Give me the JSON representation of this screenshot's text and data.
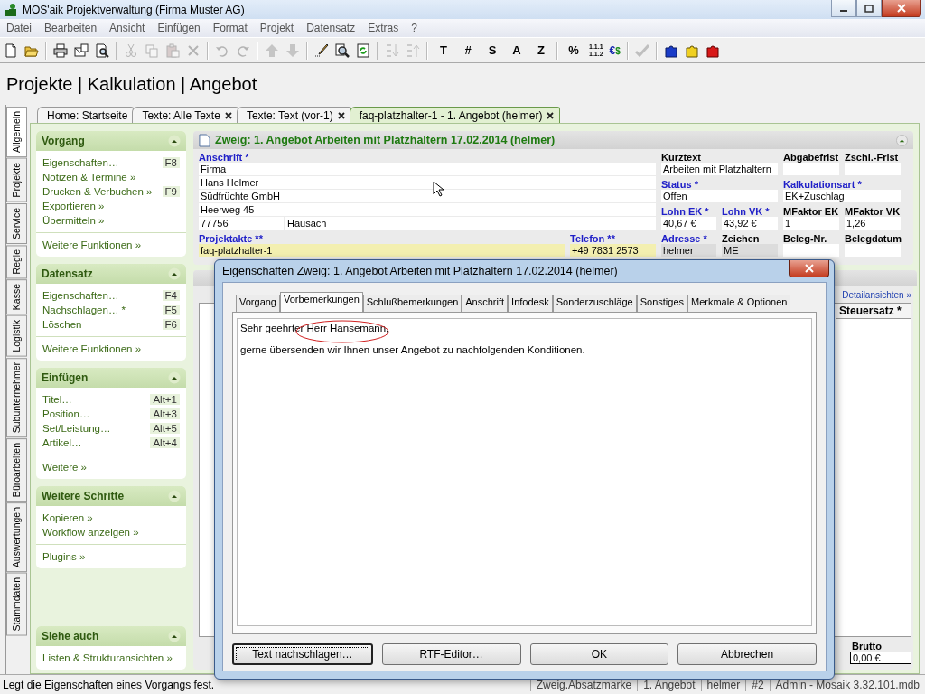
{
  "window": {
    "title": "MOS'aik Projektverwaltung (Firma Muster AG)"
  },
  "menu": [
    "Datei",
    "Bearbeiten",
    "Ansicht",
    "Einfügen",
    "Format",
    "Projekt",
    "Datensatz",
    "Extras",
    "?"
  ],
  "toolbar": [
    {
      "kind": "icon",
      "disabled": false
    },
    {
      "kind": "icon",
      "disabled": false
    },
    {
      "kind": "separator"
    },
    {
      "kind": "icon",
      "disabled": false
    },
    {
      "kind": "icon",
      "disabled": false
    },
    {
      "kind": "icon",
      "disabled": false
    },
    {
      "kind": "separator"
    },
    {
      "kind": "icon",
      "disabled": true
    },
    {
      "kind": "icon",
      "disabled": true
    },
    {
      "kind": "icon",
      "disabled": true
    },
    {
      "kind": "icon",
      "disabled": true
    },
    {
      "kind": "separator"
    },
    {
      "kind": "icon",
      "disabled": true
    },
    {
      "kind": "icon",
      "disabled": true
    },
    {
      "kind": "separator"
    },
    {
      "kind": "icon",
      "disabled": true
    },
    {
      "kind": "icon",
      "disabled": true
    },
    {
      "kind": "separator"
    },
    {
      "kind": "icon",
      "disabled": false
    },
    {
      "kind": "icon",
      "disabled": false
    },
    {
      "kind": "icon",
      "disabled": false
    },
    {
      "kind": "separator"
    },
    {
      "kind": "icon",
      "disabled": true
    },
    {
      "kind": "icon",
      "disabled": true
    },
    {
      "kind": "separator"
    },
    {
      "kind": "text",
      "label": "T"
    },
    {
      "kind": "text",
      "label": "#"
    },
    {
      "kind": "text",
      "label": "S"
    },
    {
      "kind": "text",
      "label": "A"
    },
    {
      "kind": "text",
      "label": "Z"
    },
    {
      "kind": "separator"
    },
    {
      "kind": "text",
      "label": "%"
    },
    {
      "kind": "stack",
      "lines": [
        "1.1.1",
        "1.1.2"
      ]
    },
    {
      "kind": "pair",
      "parts": [
        "€",
        "$"
      ]
    },
    {
      "kind": "separator"
    },
    {
      "kind": "icon",
      "disabled": true
    },
    {
      "kind": "separator"
    },
    {
      "kind": "icon",
      "disabled": false
    },
    {
      "kind": "icon",
      "disabled": false
    },
    {
      "kind": "icon",
      "disabled": false
    }
  ],
  "breadcrumb": "Projekte | Kalkulation | Angebot",
  "side_tabs": [
    {
      "label": "Allgemein",
      "selected": true
    },
    {
      "label": "Projekte",
      "selected": false
    },
    {
      "label": "Service",
      "selected": false
    },
    {
      "label": "Regie",
      "selected": false
    },
    {
      "label": "Kasse",
      "selected": false
    },
    {
      "label": "Logistik",
      "selected": false
    },
    {
      "label": "Subunternehmer",
      "selected": false
    },
    {
      "label": "Büroarbeiten",
      "selected": false
    },
    {
      "label": "Auswertungen",
      "selected": false
    },
    {
      "label": "Stammdaten",
      "selected": false
    }
  ],
  "doc_tabs": [
    {
      "label": "Home: Startseite",
      "closable": false,
      "selected": false
    },
    {
      "label": "Texte: Alle Texte",
      "closable": true,
      "selected": false
    },
    {
      "label": "Texte: Text (vor-1)",
      "closable": true,
      "selected": false
    },
    {
      "label": "faq-platzhalter-1 - 1. Angebot (helmer)",
      "closable": true,
      "selected": true
    }
  ],
  "task_panes": [
    {
      "title": "Vorgang",
      "expanded": true,
      "groups": [
        [
          {
            "label": "Eigenschaften…",
            "key": "F8"
          },
          {
            "label": "Notizen & Termine »"
          },
          {
            "label": "Drucken & Verbuchen »",
            "key": "F9"
          },
          {
            "label": "Exportieren »"
          },
          {
            "label": "Übermitteln »"
          }
        ],
        [
          {
            "label": "Weitere Funktionen »"
          }
        ]
      ]
    },
    {
      "title": "Datensatz",
      "expanded": true,
      "groups": [
        [
          {
            "label": "Eigenschaften…",
            "key": "F4"
          },
          {
            "label": "Nachschlagen… *",
            "key": "F5"
          },
          {
            "label": "Löschen",
            "key": "F6"
          }
        ],
        [
          {
            "label": "Weitere Funktionen »"
          }
        ]
      ]
    },
    {
      "title": "Einfügen",
      "expanded": true,
      "groups": [
        [
          {
            "label": "Titel…",
            "key": "Alt+1"
          },
          {
            "label": "Position…",
            "key": "Alt+3"
          },
          {
            "label": "Set/Leistung…",
            "key": "Alt+5"
          },
          {
            "label": "Artikel…",
            "key": "Alt+4"
          }
        ],
        [
          {
            "label": "Weitere »"
          }
        ]
      ]
    },
    {
      "title": "Weitere Schritte",
      "expanded": true,
      "groups": [
        [
          {
            "label": "Kopieren »"
          },
          {
            "label": "Workflow anzeigen »"
          }
        ],
        [
          {
            "label": "Plugins »"
          }
        ]
      ]
    },
    {
      "title": "Siehe auch",
      "expanded": true,
      "groups": [
        [
          {
            "label": "Listen & Strukturansichten »"
          }
        ]
      ]
    }
  ],
  "record": {
    "title": "Zweig: 1. Angebot Arbeiten mit Platzhaltern 17.02.2014 (helmer)",
    "expanded": true,
    "anschrift": {
      "label": "Anschrift *",
      "required": true,
      "lines": [
        "Firma",
        "Hans Helmer",
        "Südfrüchte GmbH",
        "Heerweg 45"
      ],
      "zip": "77756",
      "city": "Hausach"
    },
    "kurztext": {
      "label": "Kurztext",
      "required": false,
      "kind": "input",
      "value": "Arbeiten mit Platzhaltern"
    },
    "abgabefrist": {
      "label": "Abgabefrist",
      "required": false,
      "kind": "input"
    },
    "zschl_frist": {
      "label": "Zschl.-Frist",
      "required": false,
      "kind": "input"
    },
    "status": {
      "label": "Status *",
      "required": true,
      "kind": "input",
      "value": "Offen"
    },
    "kalkulationsart": {
      "label": "Kalkulationsart *",
      "required": true,
      "kind": "input",
      "value": "EK+Zuschlag"
    },
    "lohn_ek": {
      "label": "Lohn EK *",
      "required": true,
      "kind": "input",
      "value": "40,67 €"
    },
    "lohn_vk": {
      "label": "Lohn VK *",
      "required": true,
      "kind": "input",
      "value": "43,92 €"
    },
    "mfaktor_ek": {
      "label": "MFaktor EK",
      "required": false,
      "kind": "input",
      "value": "1"
    },
    "mfaktor_vk": {
      "label": "MFaktor VK",
      "required": false,
      "kind": "input",
      "value": "1,26"
    },
    "projektakte": {
      "label": "Projektakte **",
      "required": true,
      "kind": "lookup",
      "value": "faq-platzhalter-1"
    },
    "telefon": {
      "label": "Telefon **",
      "required": true,
      "kind": "lookup",
      "value": "+49 7831 2573"
    },
    "adresse": {
      "label": "Adresse *",
      "required": true,
      "kind": "readonly",
      "value": "helmer"
    },
    "zeichen": {
      "label": "Zeichen",
      "required": false,
      "kind": "readonly",
      "value": "ME"
    },
    "beleg_nr": {
      "label": "Beleg-Nr.",
      "required": false,
      "kind": "input"
    },
    "belegdatum": {
      "label": "Belegdatum",
      "required": false,
      "kind": "input"
    }
  },
  "detail": {
    "link": "Detailansichten »",
    "column": "Steuersatz *",
    "total_label": "Brutto",
    "total_value": "0,00 €"
  },
  "dialog": {
    "title": "Eigenschaften Zweig: 1. Angebot Arbeiten mit Platzhaltern 17.02.2014 (helmer)",
    "tabs": [
      {
        "label": "Vorgang",
        "selected": false
      },
      {
        "label": "Vorbemerkungen",
        "selected": true
      },
      {
        "label": "Schlußbemerkungen",
        "selected": false
      },
      {
        "label": "Anschrift",
        "selected": false
      },
      {
        "label": "Infodesk",
        "selected": false
      },
      {
        "label": "Sonderzuschläge",
        "selected": false
      },
      {
        "label": "Sonstiges",
        "selected": false
      },
      {
        "label": "Merkmale & Optionen",
        "selected": false
      }
    ],
    "text": [
      "Sehr geehrter Herr Hansemann,",
      "gerne übersenden wir Ihnen unser Angebot zu nachfolgenden Konditionen."
    ],
    "buttons": [
      {
        "label": "Text nachschlagen…",
        "focused": true
      },
      {
        "label": "RTF-Editor…",
        "focused": false
      },
      {
        "label": "OK",
        "focused": false
      },
      {
        "label": "Abbrechen",
        "focused": false
      }
    ]
  },
  "status_bar": {
    "message": "Legt die Eigenschaften eines Vorgangs fest.",
    "cells": [
      "Zweig.Absatzmarke",
      "1. Angebot",
      "helmer",
      "#2",
      "Admin - Mosaik 3.32.101.mdb"
    ]
  }
}
